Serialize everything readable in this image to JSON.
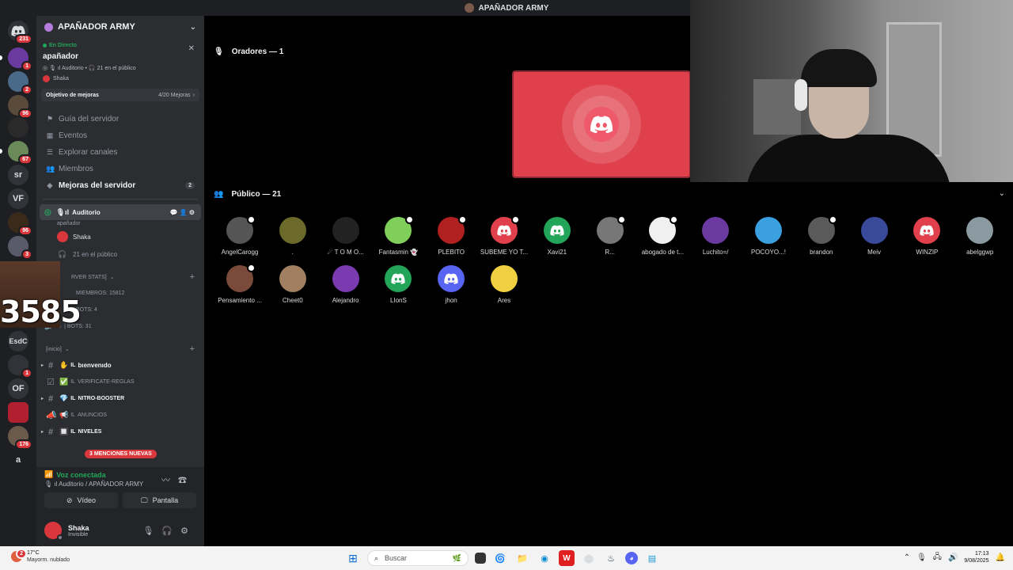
{
  "window": {
    "title": "APAÑADOR ARMY"
  },
  "rail": {
    "servers": [
      {
        "badge": "231",
        "text": ""
      },
      {
        "badge": "1",
        "text": ""
      },
      {
        "badge": "2",
        "text": ""
      },
      {
        "badge": "96",
        "text": ""
      },
      {
        "badge": "",
        "text": ""
      },
      {
        "badge": "67",
        "text": ""
      },
      {
        "badge": "",
        "text": "sr"
      },
      {
        "badge": "",
        "text": "VF"
      },
      {
        "badge": "96",
        "text": ""
      },
      {
        "badge": "3",
        "text": ""
      },
      {
        "badge": "",
        "text": "EsdC"
      },
      {
        "badge": "1",
        "text": ""
      },
      {
        "badge": "",
        "text": "OF"
      },
      {
        "badge": "",
        "text": ""
      },
      {
        "badge": "176",
        "text": ""
      },
      {
        "badge": "",
        "text": "a"
      }
    ]
  },
  "sidebar": {
    "guild_name": "APAÑADOR ARMY",
    "live": {
      "tag": "En Directo",
      "title": "apañador",
      "channel": "Auditorio",
      "audience": "21 en el público",
      "host": "Shaka"
    },
    "boost": {
      "label": "Objetivo de mejoras",
      "count": "4/20 Mejoras"
    },
    "nav": [
      {
        "label": "Guía del servidor",
        "icon": "signpost-icon"
      },
      {
        "label": "Eventos",
        "icon": "calendar-icon"
      },
      {
        "label": "Explorar canales",
        "icon": "channels-icon"
      },
      {
        "label": "Miembros",
        "icon": "members-icon"
      },
      {
        "label": "Mejoras del servidor",
        "icon": "boost-icon",
        "count": "2"
      }
    ],
    "voice_channel": {
      "name": "Auditorio",
      "topic": "apañador",
      "member": "Shaka",
      "audience": "21 en el público"
    },
    "stats_category": "rver stats]",
    "stats": [
      {
        "label": "miembros: 15812"
      },
      {
        "label": "bots: 4"
      },
      {
        "label": "| bots: 31"
      }
    ],
    "overlay_number": "3585",
    "inicio_category": "[inicio]",
    "channels": [
      {
        "name": "bιenvenιdo",
        "emoji": "✋",
        "bold": true
      },
      {
        "name": "verificate-reglas",
        "emoji": "✅",
        "bold": false
      },
      {
        "name": "nitro-booster",
        "emoji": "💎",
        "bold": true
      },
      {
        "name": "anuncios",
        "emoji": "📢",
        "bold": false
      },
      {
        "name": "niveles",
        "emoji": "🔲",
        "bold": true
      }
    ],
    "mentions": "3 MENCIONES NUEVAS"
  },
  "voicebar": {
    "status": "Voz conectada",
    "route": "Auditorio / APAÑADOR ARMY",
    "video": "Vídeo",
    "screen": "Pantalla"
  },
  "user": {
    "name": "Shaka",
    "status": "Invisible"
  },
  "stage": {
    "speakers_label": "Oradores — 1",
    "audience_label": "Público — 21",
    "audience": [
      {
        "name": "AngelCarogg",
        "color": "#555555",
        "mod": true
      },
      {
        "name": ".",
        "color": "#6b6a2a",
        "mod": false
      },
      {
        "name": "☄ T O M O...",
        "color": "#222222",
        "mod": false
      },
      {
        "name": "Fantasmin 👻",
        "color": "#7fcf5a",
        "mod": true
      },
      {
        "name": "PLEBITO",
        "color": "#b02020",
        "mod": true
      },
      {
        "name": "SUBEME YO T...",
        "color": "#e0404c",
        "mod": true,
        "discord": true
      },
      {
        "name": "Xavi21",
        "color": "#23a559",
        "mod": false,
        "discord": true
      },
      {
        "name": "R...",
        "color": "#777777",
        "mod": true
      },
      {
        "name": "abogado de t...",
        "color": "#f0f0f0",
        "mod": true
      },
      {
        "name": "Luchito=/",
        "color": "#6a3aa0",
        "mod": false
      },
      {
        "name": "POCOYO...!",
        "color": "#3aa0e0",
        "mod": false
      },
      {
        "name": "brandon",
        "color": "#5a5a5a",
        "mod": true
      },
      {
        "name": "Meiv",
        "color": "#3a4a9a",
        "mod": false
      },
      {
        "name": "WINZIP",
        "color": "#e0404c",
        "mod": false,
        "discord": true
      },
      {
        "name": "abelggwp",
        "color": "#8a9aa0",
        "mod": false
      },
      {
        "name": "Pensamiento ...",
        "color": "#7a4a3a",
        "mod": true
      },
      {
        "name": "Cheet0",
        "color": "#a08060",
        "mod": false
      },
      {
        "name": "Alejandro",
        "color": "#7a3ab0",
        "mod": false
      },
      {
        "name": "LIonS",
        "color": "#23a559",
        "mod": false,
        "discord": true
      },
      {
        "name": "jhon",
        "color": "#5865f2",
        "mod": false,
        "discord": true
      },
      {
        "name": "Ares",
        "color": "#f0d040",
        "mod": false
      }
    ]
  },
  "taskbar": {
    "weather_temp": "17°C",
    "weather_desc": "Mayorm. nublado",
    "weather_badge": "2",
    "search_placeholder": "Buscar",
    "time": "17:13",
    "date": "9/08/2025"
  }
}
